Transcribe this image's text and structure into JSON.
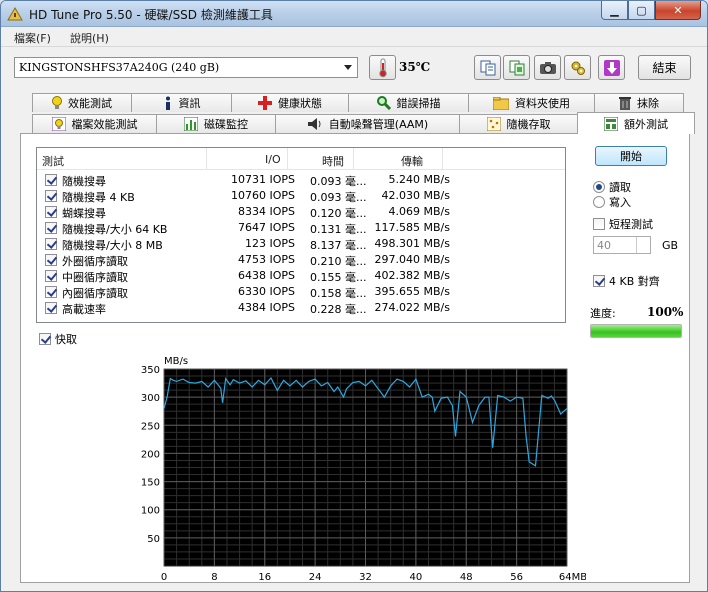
{
  "window": {
    "title": "HD Tune Pro 5.50 - 硬碟/SSD 檢測維護工具",
    "controls": {
      "minimize": "▁",
      "maximize": "▢",
      "close": "✕"
    }
  },
  "menu": [
    "檔案(F)",
    "說明(H)"
  ],
  "toolbar": {
    "drive": "KINGSTONSHFS37A240G (240 gB)",
    "temperature": "35℃",
    "exit_label": "結束",
    "icons": [
      "copy-info-icon",
      "copy-screenshot-icon",
      "camera-icon",
      "options-icon",
      "save-icon"
    ]
  },
  "tabs_top": [
    "效能測試",
    "資訊",
    "健康狀態",
    "錯誤掃描",
    "資料夾使用",
    "抹除"
  ],
  "tabs_bottom": [
    "檔案效能測試",
    "磁碟監控",
    "自動噪聲管理(AAM)",
    "隨機存取",
    "額外測試"
  ],
  "active_tab": "額外測試",
  "results": {
    "headers": {
      "test": "測試",
      "io": "I/O",
      "time": "時間",
      "transfer": "傳輸"
    },
    "rows": [
      {
        "checked": true,
        "name": "隨機搜尋",
        "io": "10731 IOPS",
        "time": "0.093 毫...",
        "transfer": "5.240 MB/s"
      },
      {
        "checked": true,
        "name": "隨機搜尋 4 KB",
        "io": "10760 IOPS",
        "time": "0.093 毫...",
        "transfer": "42.030 MB/s"
      },
      {
        "checked": true,
        "name": "蝴蝶搜尋",
        "io": "8334 IOPS",
        "time": "0.120 毫...",
        "transfer": "4.069 MB/s"
      },
      {
        "checked": true,
        "name": "隨機搜尋/大小 64 KB",
        "io": "7647 IOPS",
        "time": "0.131 毫...",
        "transfer": "117.585 MB/s"
      },
      {
        "checked": true,
        "name": "隨機搜尋/大小 8 MB",
        "io": "123 IOPS",
        "time": "8.137 毫...",
        "transfer": "498.301 MB/s"
      },
      {
        "checked": true,
        "name": "外圈循序讀取",
        "io": "4753 IOPS",
        "time": "0.210 毫...",
        "transfer": "297.040 MB/s"
      },
      {
        "checked": true,
        "name": "中圈循序讀取",
        "io": "6438 IOPS",
        "time": "0.155 毫...",
        "transfer": "402.382 MB/s"
      },
      {
        "checked": true,
        "name": "內圈循序讀取",
        "io": "6330 IOPS",
        "time": "0.158 毫...",
        "transfer": "395.655 MB/s"
      },
      {
        "checked": true,
        "name": "高載速率",
        "io": "4384 IOPS",
        "time": "0.228 毫...",
        "transfer": "274.022 MB/s"
      }
    ]
  },
  "fast_mode": {
    "checked": true,
    "label": "快取"
  },
  "side": {
    "start_label": "開始",
    "read_label": "讀取",
    "write_label": "寫入",
    "mode": "read",
    "short_test_label": "短程測試",
    "short_test_checked": false,
    "short_test_value": "40",
    "short_test_unit": "GB",
    "align_label": "4 KB 對齊",
    "align_checked": true,
    "progress_label": "進度:",
    "progress_text": "100%",
    "progress": 1.0,
    "colors": {
      "progress_fill": "#37c11f"
    }
  },
  "chart_data": {
    "type": "line",
    "ylabel": "MB/s",
    "xlabel": "MB",
    "xlim": [
      0,
      64
    ],
    "ylim": [
      0,
      350
    ],
    "x_ticks": [
      0,
      8,
      16,
      24,
      32,
      40,
      48,
      56,
      64
    ],
    "x_tick_labels": [
      "0",
      "8",
      "16",
      "24",
      "32",
      "40",
      "48",
      "56",
      "64MB"
    ],
    "y_ticks": [
      50,
      100,
      150,
      200,
      250,
      300,
      350
    ],
    "grid": true,
    "background": "#000000",
    "grid_color": "#5a5a5a",
    "series": [
      {
        "color": "#2ea8df",
        "x": [
          0,
          0.5,
          1,
          1.5,
          2,
          3,
          4,
          5,
          6,
          7,
          8,
          9,
          9.3,
          9.8,
          10.5,
          11,
          12,
          13,
          14,
          15,
          16,
          17,
          18,
          19,
          20,
          21,
          22,
          23,
          24,
          25,
          26,
          27,
          27.6,
          28.5,
          29,
          30,
          31,
          32,
          33,
          34,
          35,
          36,
          37,
          38,
          39,
          40,
          41,
          42,
          42.6,
          43,
          44,
          45,
          45.8,
          46.3,
          47,
          48,
          49,
          50,
          51,
          51.6,
          52.2,
          53,
          54,
          55,
          56,
          57,
          57.5,
          58,
          59,
          60,
          61,
          61.5,
          62,
          63,
          64
        ],
        "y": [
          280,
          300,
          333,
          330,
          328,
          332,
          326,
          325,
          328,
          318,
          330,
          316,
          290,
          333,
          322,
          331,
          325,
          329,
          318,
          330,
          322,
          334,
          312,
          330,
          320,
          330,
          318,
          328,
          332,
          320,
          326,
          310,
          318,
          300,
          315,
          326,
          328,
          320,
          330,
          315,
          300,
          320,
          332,
          328,
          318,
          332,
          300,
          305,
          300,
          275,
          298,
          300,
          285,
          230,
          310,
          300,
          255,
          285,
          300,
          300,
          210,
          303,
          300,
          293,
          300,
          298,
          230,
          185,
          178,
          303,
          298,
          302,
          295,
          270,
          280
        ]
      }
    ]
  }
}
